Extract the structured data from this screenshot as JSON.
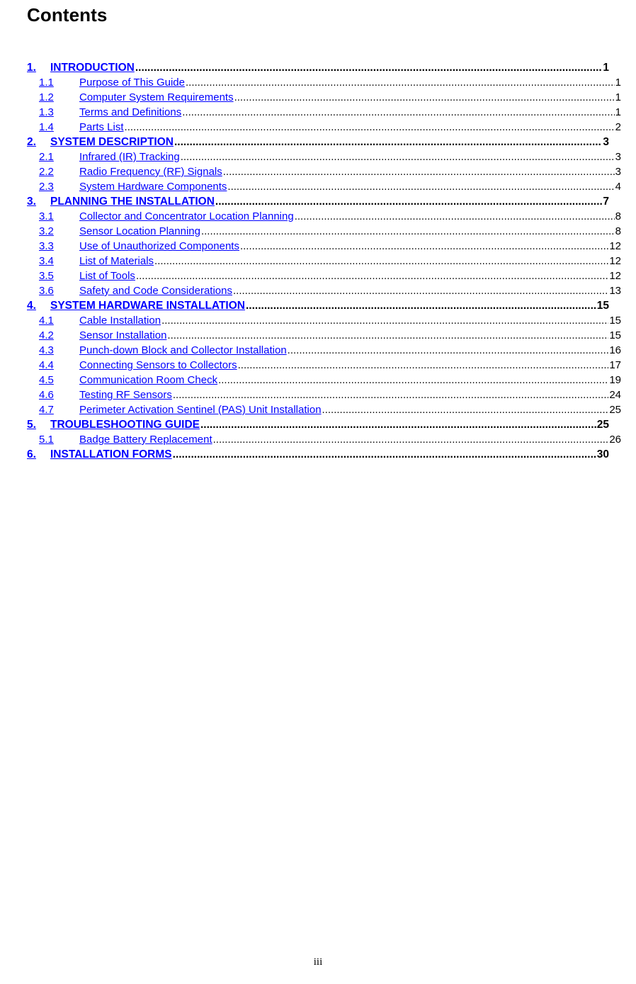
{
  "document": {
    "heading": "Contents",
    "page_number": "iii"
  },
  "toc": {
    "dot_leader": "................................................................................................................................................................................................................................................................",
    "entries": [
      {
        "level": 1,
        "num": "1.",
        "label": "INTRODUCTION",
        "page": "1"
      },
      {
        "level": 2,
        "num": "1.1",
        "label": "Purpose of This Guide",
        "page": "1"
      },
      {
        "level": 2,
        "num": "1.2",
        "label": "Computer System Requirements",
        "page": "1"
      },
      {
        "level": 2,
        "num": "1.3",
        "label": "Terms and Definitions",
        "page": "1"
      },
      {
        "level": 2,
        "num": "1.4",
        "label": "Parts List",
        "page": "2"
      },
      {
        "level": 1,
        "num": "2.",
        "label": "SYSTEM DESCRIPTION",
        "page": "3"
      },
      {
        "level": 2,
        "num": "2.1",
        "label": "Infrared (IR) Tracking",
        "page": "3"
      },
      {
        "level": 2,
        "num": "2.2",
        "label": "Radio Frequency (RF) Signals",
        "page": "3"
      },
      {
        "level": 2,
        "num": "2.3",
        "label": "System Hardware Components",
        "page": "4"
      },
      {
        "level": 1,
        "num": "3.",
        "label": "PLANNING THE INSTALLATION",
        "page": "7"
      },
      {
        "level": 2,
        "num": "3.1",
        "label": "Collector and Concentrator Location Planning",
        "page": "8"
      },
      {
        "level": 2,
        "num": "3.2",
        "label": "Sensor Location Planning",
        "page": "8"
      },
      {
        "level": 2,
        "num": "3.3",
        "label": "Use of Unauthorized Components",
        "page": "12"
      },
      {
        "level": 2,
        "num": "3.4",
        "label": "List of Materials",
        "page": "12"
      },
      {
        "level": 2,
        "num": "3.5",
        "label": "List of Tools",
        "page": "12"
      },
      {
        "level": 2,
        "num": "3.6",
        "label": "Safety and Code Considerations",
        "page": "13"
      },
      {
        "level": 1,
        "num": "4.",
        "label": "SYSTEM HARDWARE INSTALLATION",
        "page": "15"
      },
      {
        "level": 2,
        "num": "4.1",
        "label": "Cable Installation",
        "page": "15"
      },
      {
        "level": 2,
        "num": "4.2",
        "label": "Sensor Installation",
        "page": "15"
      },
      {
        "level": 2,
        "num": "4.3",
        "label": "Punch-down Block and Collector Installation",
        "page": "16"
      },
      {
        "level": 2,
        "num": "4.4",
        "label": "Connecting Sensors to Collectors",
        "page": "17"
      },
      {
        "level": 2,
        "num": "4.5",
        "label": "Communication Room Check",
        "page": "19"
      },
      {
        "level": 2,
        "num": "4.6",
        "label": "Testing RF Sensors",
        "page": "24"
      },
      {
        "level": 2,
        "num": "4.7",
        "label": "Perimeter Activation Sentinel (PAS) Unit Installation",
        "page": "25"
      },
      {
        "level": 1,
        "num": "5.",
        "label": "TROUBLESHOOTING GUIDE",
        "page": "25"
      },
      {
        "level": 2,
        "num": "5.1",
        "label": "Badge Battery Replacement",
        "page": "26"
      },
      {
        "level": 1,
        "num": "6.",
        "label": "INSTALLATION FORMS",
        "page": "30"
      }
    ]
  },
  "colors": {
    "link": "#0000ff",
    "text": "#000000",
    "background": "#ffffff"
  }
}
